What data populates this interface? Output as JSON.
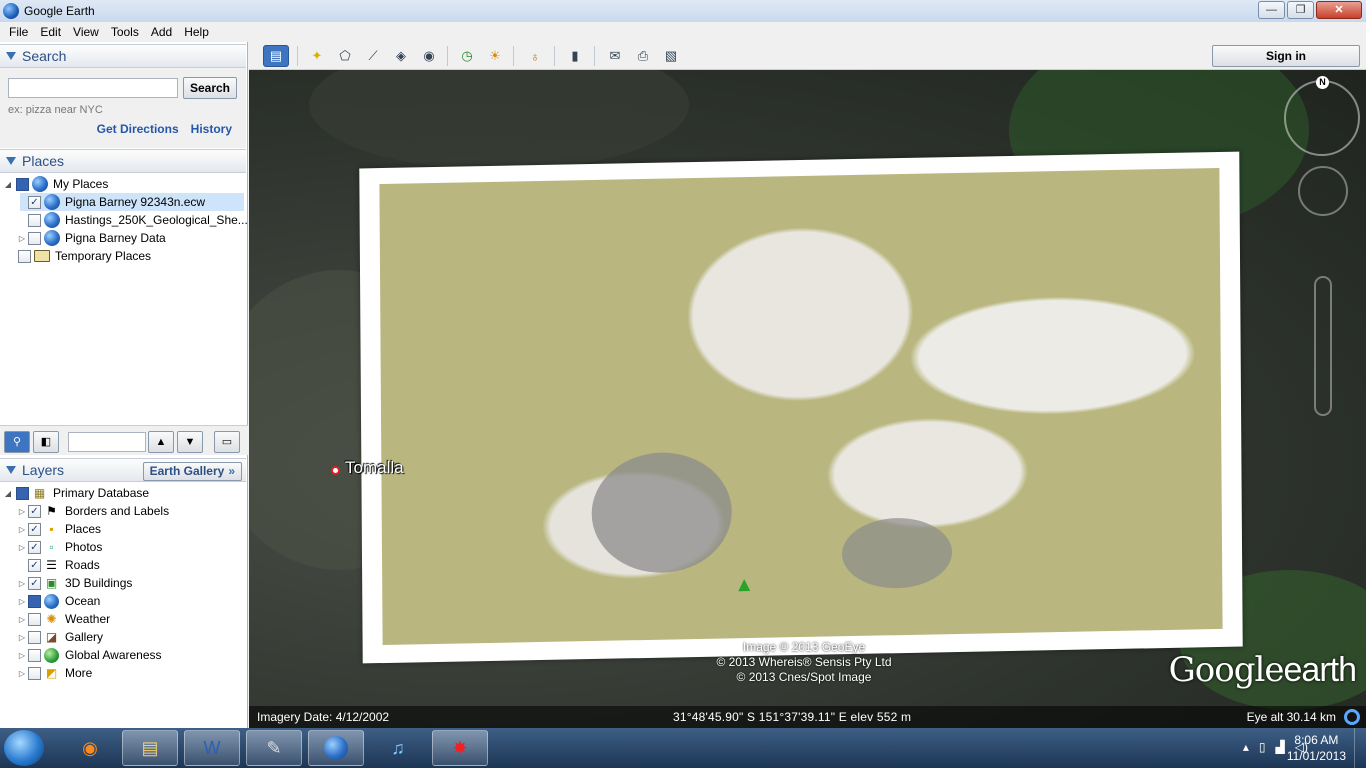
{
  "window": {
    "title": "Google Earth",
    "minimize": "—",
    "maximize": "❐",
    "close": "✕"
  },
  "menu": [
    "File",
    "Edit",
    "View",
    "Tools",
    "Add",
    "Help"
  ],
  "search": {
    "header": "Search",
    "placeholder": "",
    "button": "Search",
    "hint": "ex: pizza near NYC",
    "get_directions": "Get Directions",
    "history": "History"
  },
  "places": {
    "header": "Places",
    "items": [
      {
        "label": "My Places",
        "checked": "partial"
      },
      {
        "label": "Pigna Barney 92343n.ecw",
        "checked": true,
        "selected": true
      },
      {
        "label": "Hastings_250K_Geological_She...",
        "checked": false
      },
      {
        "label": "Pigna Barney Data",
        "checked": false
      },
      {
        "label": "Temporary Places",
        "checked": false
      }
    ]
  },
  "layers": {
    "header": "Layers",
    "gallery_button": "Earth Gallery",
    "items": [
      {
        "label": "Primary Database"
      },
      {
        "label": "Borders and Labels"
      },
      {
        "label": "Places"
      },
      {
        "label": "Photos"
      },
      {
        "label": "Roads"
      },
      {
        "label": "3D Buildings"
      },
      {
        "label": "Ocean"
      },
      {
        "label": "Weather"
      },
      {
        "label": "Gallery"
      },
      {
        "label": "Global Awareness"
      },
      {
        "label": "More"
      }
    ]
  },
  "toolbar": {
    "sign_in": "Sign in"
  },
  "map": {
    "place_label": "Tomalla",
    "credits": [
      "Image © 2013 GeoEye",
      "© 2013 Whereis® Sensis Pty Ltd",
      "© 2013 Cnes/Spot Image"
    ],
    "logo_google": "Google",
    "logo_earth": "earth",
    "compass_n": "N"
  },
  "status": {
    "imagery_date": "Imagery Date: 4/12/2002",
    "coords": "31°48'45.90\" S 151°37'39.11\" E elev   552 m",
    "eye_alt": "Eye alt    30.14 km"
  },
  "taskbar": {
    "time": "8:06 AM",
    "date": "11/01/2013"
  }
}
